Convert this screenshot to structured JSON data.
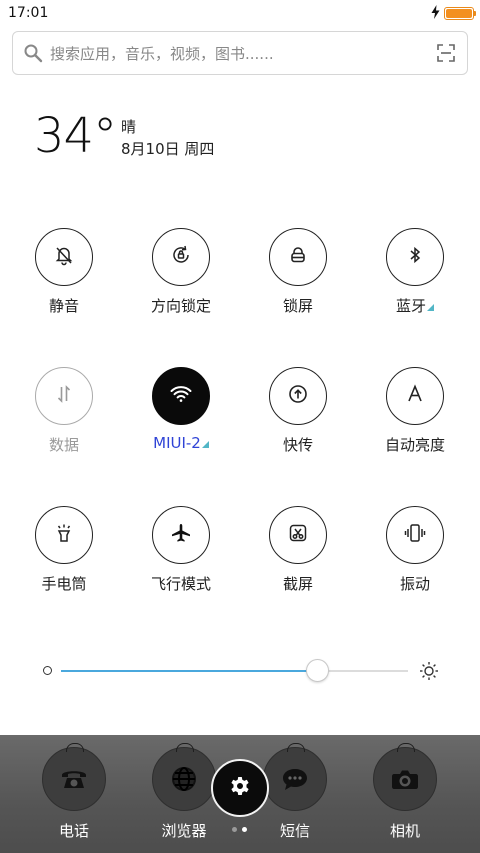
{
  "status_bar": {
    "time": "17:01",
    "battery_level": 1.0,
    "charging": true,
    "battery_color": "#f39020"
  },
  "search": {
    "placeholder": "搜索应用，音乐，视频，图书......"
  },
  "weather": {
    "temperature": "34°",
    "condition": "晴",
    "date": "8月10日 周四"
  },
  "toggles": [
    {
      "label": "静音",
      "icon": "bell-muted-icon",
      "state": "off"
    },
    {
      "label": "方向锁定",
      "icon": "rotation-lock-icon",
      "state": "off"
    },
    {
      "label": "锁屏",
      "icon": "lock-icon",
      "state": "off"
    },
    {
      "label": "蓝牙",
      "icon": "bluetooth-icon",
      "state": "off",
      "has_more": true
    },
    {
      "label": "数据",
      "icon": "mobile-data-icon",
      "state": "disabled"
    },
    {
      "label": "MIUI-2",
      "icon": "wifi-icon",
      "state": "on",
      "has_more": true
    },
    {
      "label": "快传",
      "icon": "quick-transfer-icon",
      "state": "off"
    },
    {
      "label": "自动亮度",
      "icon": "auto-brightness-icon",
      "state": "off"
    },
    {
      "label": "手电筒",
      "icon": "flashlight-icon",
      "state": "off"
    },
    {
      "label": "飞行模式",
      "icon": "airplane-icon",
      "state": "off"
    },
    {
      "label": "截屏",
      "icon": "screenshot-icon",
      "state": "off"
    },
    {
      "label": "振动",
      "icon": "vibrate-icon",
      "state": "off"
    }
  ],
  "brightness": {
    "level": 0.74,
    "accent": "#4aa8dd"
  },
  "dock": {
    "apps": [
      {
        "label": "电话",
        "icon": "phone-icon"
      },
      {
        "label": "浏览器",
        "icon": "globe-icon"
      },
      {
        "label": "短信",
        "icon": "message-icon"
      },
      {
        "label": "相机",
        "icon": "camera-icon"
      }
    ],
    "settings_icon": "gear-icon",
    "pages": 2,
    "current_page": 2
  },
  "colors": {
    "wifi_label": "#2f43d6",
    "more_indicator": "#52b6c6"
  }
}
